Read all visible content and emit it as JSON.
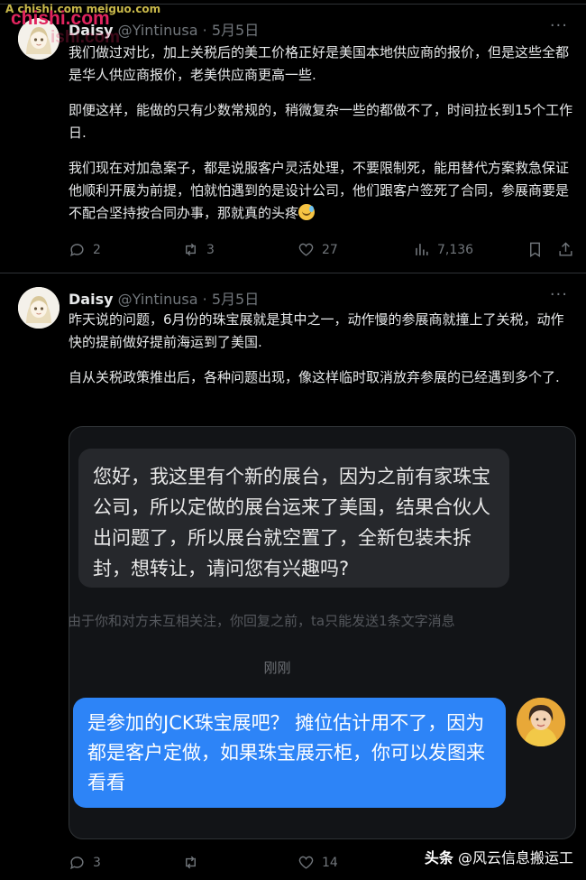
{
  "watermark": {
    "small": "A chishi.com meiguo.com",
    "big": "chishi.com",
    "ghost": "ishi.com"
  },
  "tweets": [
    {
      "name": "Daisy",
      "handle": "@Yintinusa",
      "dot": "·",
      "date": "5月5日",
      "more": "···",
      "paragraphs": [
        "我们做过对比，加上关税后的美工价格正好是美国本地供应商的报价，但是这些全都是华人供应商报价，老美供应商更高一些.",
        "即便这样，能做的只有少数常规的，稍微复杂一些的都做不了，时间拉长到15个工作日.",
        "我们现在对加急案子，都是说服客户灵活处理，不要限制死，能用替代方案救急保证他顺利开展为前提，怕就怕遇到的是设计公司，他们跟客户签死了合同，参展商要是不配合坚持按合同办事，那就真的头疼"
      ],
      "emoji": "sweat-smile-emoji",
      "stats": {
        "replies": "2",
        "reposts": "3",
        "likes": "27",
        "views": "7,136"
      }
    },
    {
      "name": "Daisy",
      "handle": "@Yintinusa",
      "dot": "·",
      "date": "5月5日",
      "more": "···",
      "paragraphs": [
        "昨天说的问题，6月份的珠宝展就是其中之一，动作慢的参展商就撞上了关税，动作快的提前做好提前海运到了美国.",
        "自从关税政策推出后，各种问题出现，像这样临时取消放弃参展的已经遇到多个了."
      ],
      "chat": {
        "incoming": "您好，我这里有个新的展台，因为之前有家珠宝公司，所以定做的展台运来了美国，结果合伙人出问题了，所以展台就空置了，全新包装未拆封，想转让，请问您有兴趣吗?",
        "notice": "由于你和对方未互相关注，你回复之前，ta只能发送1条文字消息",
        "time": "刚刚",
        "outgoing": "是参加的JCK珠宝展吧？ 摊位估计用不了，因为都是客户定做，如果珠宝展示柜，你可以发图来看看"
      },
      "stats": {
        "replies": "3",
        "reposts": "",
        "likes": "14",
        "views": ""
      }
    }
  ],
  "source": {
    "brand": "头条",
    "account": "@风云信息搬运工"
  },
  "colors": {
    "background": "#000000",
    "text": "#e7e9ea",
    "muted": "#71767b",
    "border": "#2f3336",
    "outgoing_bubble": "#2d84f7",
    "incoming_bubble": "#26282c"
  }
}
